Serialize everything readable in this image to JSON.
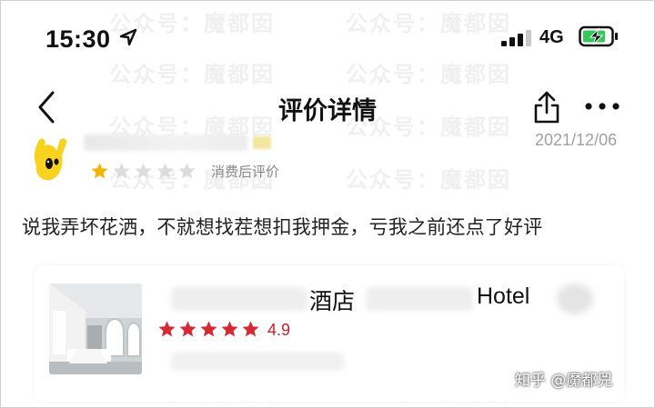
{
  "status_bar": {
    "time": "15:30",
    "network": "4G"
  },
  "nav": {
    "title": "评价详情",
    "back_icon": "chevron-left-icon",
    "share_icon": "share-icon",
    "more_icon": "more-dots-icon"
  },
  "review": {
    "date": "2021/12/06",
    "rating_stars": 1,
    "tag": "消费后评价",
    "text": "说我弄坏花洒，不就想找茬想扣我押金，亏我之前还点了好评"
  },
  "hotel": {
    "name_cn": "酒店",
    "name_en": "Hotel",
    "rating_stars": 5,
    "rating": "4.9"
  },
  "watermark": "公众号：魔都囡",
  "source_mark": "知乎 @魔都兕",
  "colors": {
    "star_active_small": "#f5b400",
    "star_inactive": "#dcdcdc",
    "star_hotel": "#d52a33",
    "rating_text": "#c81e2a"
  }
}
